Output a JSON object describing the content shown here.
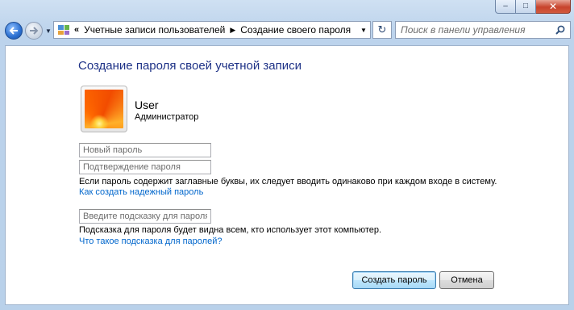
{
  "window": {
    "caption_buttons": {
      "minimize_glyph": "–",
      "maximize_glyph": "□",
      "close_glyph": "✕"
    }
  },
  "navbar": {
    "back_icon": "back-arrow-icon",
    "forward_icon": "forward-arrow-icon",
    "history_dropdown_glyph": "▼",
    "breadcrumb_overflow": "«",
    "breadcrumb": [
      {
        "label": "Учетные записи пользователей"
      },
      {
        "label": "Создание своего пароля"
      }
    ],
    "breadcrumb_separator": "▶",
    "address_dropdown_glyph": "▼",
    "refresh_glyph": "↻",
    "search": {
      "placeholder": "Поиск в панели управления",
      "value": ""
    }
  },
  "main": {
    "title": "Создание пароля своей учетной записи",
    "user": {
      "name": "User",
      "role": "Администратор"
    },
    "fields": {
      "new_password_placeholder": "Новый пароль",
      "confirm_password_placeholder": "Подтверждение пароля",
      "hint_placeholder": "Введите подсказку для пароля"
    },
    "caps_note": "Если пароль содержит заглавные буквы, их следует вводить одинаково при каждом входе в систему.",
    "strong_password_link": "Как создать надежный пароль",
    "hint_note": "Подсказка для пароля будет видна всем, кто использует этот компьютер.",
    "hint_link": "Что такое подсказка для паролей?"
  },
  "buttons": {
    "create": "Создать пароль",
    "cancel": "Отмена"
  },
  "colors": {
    "title_blue": "#1e3287",
    "link_blue": "#0066cc",
    "chrome_blue": "#b9d1ea"
  }
}
